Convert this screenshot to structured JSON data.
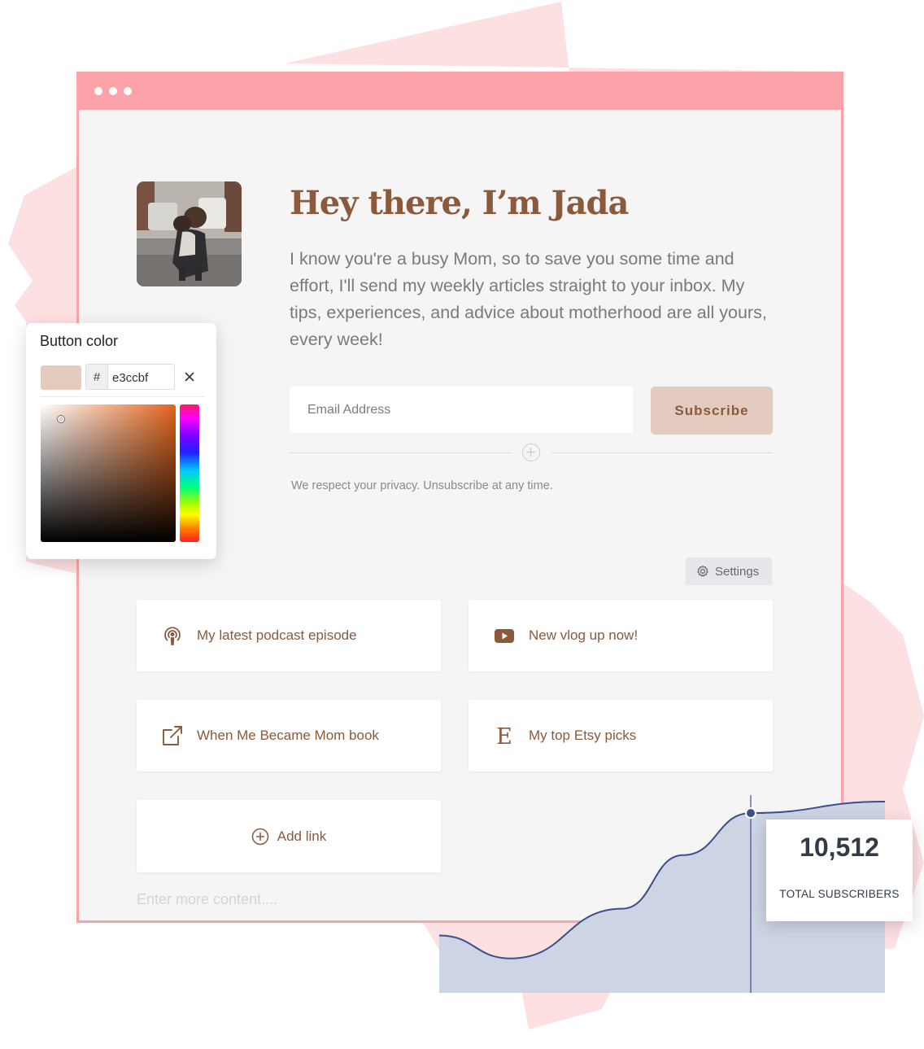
{
  "page": {
    "title": "Hey there, I’m Jada",
    "intro": "I know you're a busy Mom, so to save you some time and effort, I'll send my weekly articles straight to your inbox. My tips, experiences, and advice about motherhood are all yours, every week!",
    "email_placeholder": "Email Address",
    "subscribe_label": "Subscribe",
    "privacy": "We respect your privacy. Unsubscribe at any time.",
    "settings_label": "Settings",
    "more_placeholder": "Enter more content....",
    "links": [
      {
        "label": "My latest podcast episode",
        "icon": "podcast-icon"
      },
      {
        "label": "New vlog up now!",
        "icon": "youtube-icon"
      },
      {
        "label": "When Me Became Mom book",
        "icon": "external-link-icon"
      },
      {
        "label": "My top Etsy picks",
        "icon": "etsy-icon"
      }
    ],
    "add_link_label": "Add link"
  },
  "picker": {
    "title": "Button color",
    "hash": "#",
    "hex_value": "e3ccbf",
    "swatch_color": "#e3ccbf"
  },
  "stats": {
    "value": "10,512",
    "label": "TOTAL SUBSCRIBERS"
  },
  "colors": {
    "accent_pink": "#fba3a8",
    "brand_brown": "#8b5a3c",
    "button_color": "#e3ccbf",
    "chart_fill": "#cdd4e4",
    "chart_line": "#3c4f8c"
  },
  "chart_data": {
    "type": "area",
    "values": [
      0.3,
      0.18,
      0.44,
      0.72,
      0.94,
      1.0
    ],
    "highlight_index": 4
  }
}
